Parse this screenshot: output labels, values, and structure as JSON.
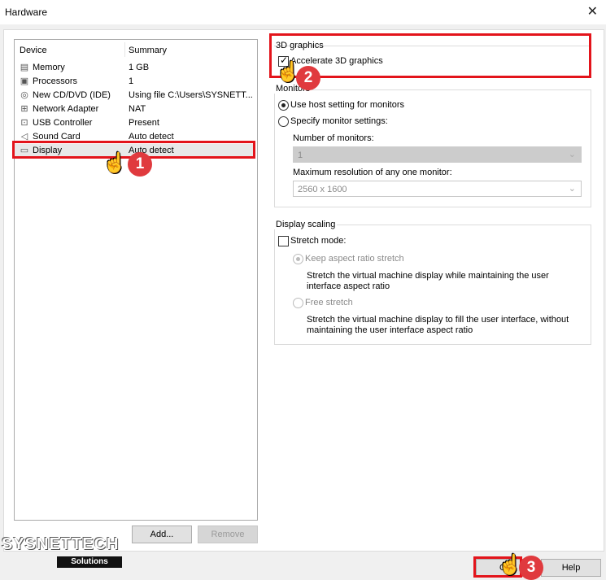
{
  "window": {
    "title": "Hardware",
    "close_glyph": "✕"
  },
  "device_list": {
    "headers": {
      "device": "Device",
      "summary": "Summary"
    },
    "items": [
      {
        "icon": "memory-icon",
        "glyph": "▤",
        "name": "Memory",
        "summary": "1 GB"
      },
      {
        "icon": "processor-icon",
        "glyph": "▣",
        "name": "Processors",
        "summary": "1"
      },
      {
        "icon": "cd-dvd-icon",
        "glyph": "◎",
        "name": "New CD/DVD (IDE)",
        "summary": "Using file C:\\Users\\SYSNETT..."
      },
      {
        "icon": "network-adapter-icon",
        "glyph": "⊞",
        "name": "Network Adapter",
        "summary": "NAT"
      },
      {
        "icon": "usb-icon",
        "glyph": "⊡",
        "name": "USB Controller",
        "summary": "Present"
      },
      {
        "icon": "sound-card-icon",
        "glyph": "◁",
        "name": "Sound Card",
        "summary": "Auto detect"
      },
      {
        "icon": "display-icon",
        "glyph": "▭",
        "name": "Display",
        "summary": "Auto detect",
        "selected": true
      }
    ],
    "add_label": "Add...",
    "remove_label": "Remove"
  },
  "graphics": {
    "group_label": "3D graphics",
    "accelerate_label": "Accelerate 3D graphics",
    "accelerate_checked": true
  },
  "monitors": {
    "group_label": "Monitors",
    "use_host_label": "Use host setting for monitors",
    "specify_label": "Specify monitor settings:",
    "selected": "use_host",
    "number_label": "Number of monitors:",
    "number_value": "1",
    "max_res_label": "Maximum resolution of any one monitor:",
    "max_res_value": "2560 x 1600"
  },
  "scaling": {
    "group_label": "Display scaling",
    "stretch_label": "Stretch mode:",
    "stretch_checked": false,
    "keep_label": "Keep aspect ratio stretch",
    "keep_desc": "Stretch the virtual machine display while maintaining the user interface aspect ratio",
    "free_label": "Free stretch",
    "free_desc": "Stretch the virtual machine display to fill the user interface, without maintaining the user interface aspect ratio"
  },
  "footer": {
    "ok_label": "OK",
    "help_label": "Help"
  },
  "annotations": {
    "step1": "1",
    "step2": "2",
    "step3": "3",
    "accent": "#e3141b"
  },
  "watermark": {
    "brand": "SYSNETTECH",
    "sub": "Solutions"
  }
}
